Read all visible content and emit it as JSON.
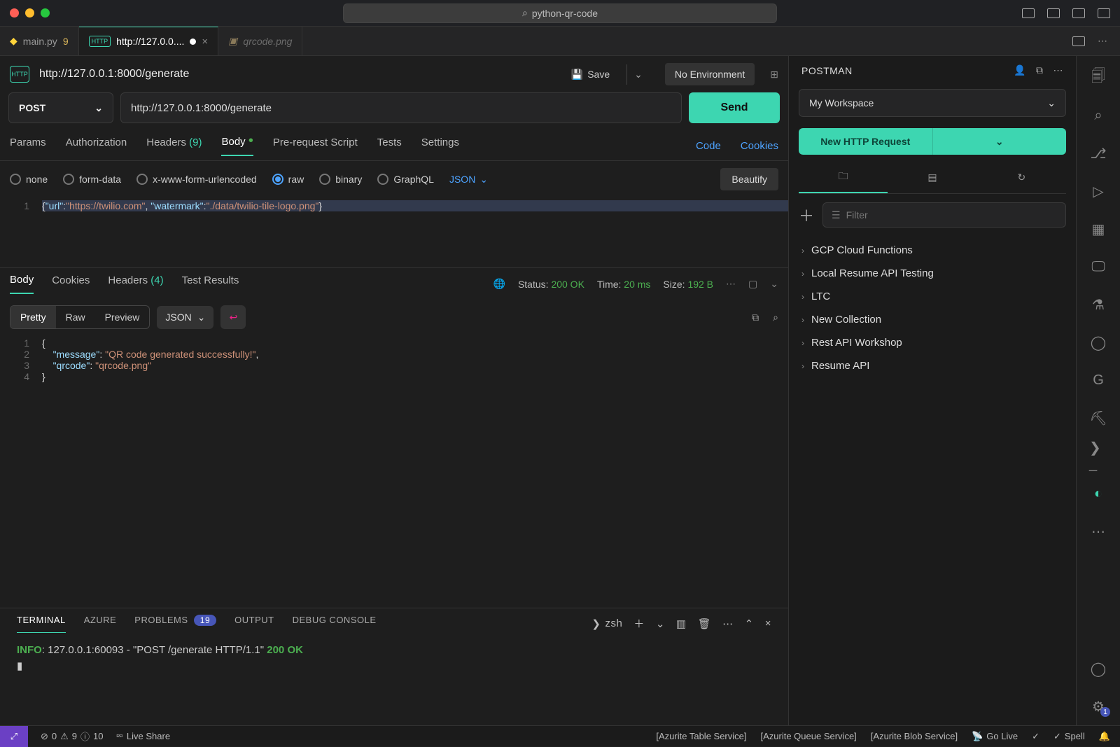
{
  "titlebar": {
    "search": "python-qr-code"
  },
  "tabs": [
    {
      "icon": "python-icon",
      "label": "main.py",
      "badge": "9"
    },
    {
      "icon": "http-icon",
      "label": "http://127.0.0....",
      "modified": true,
      "active": true
    },
    {
      "icon": "image-icon",
      "label": "qrcode.png",
      "dim": true
    }
  ],
  "request": {
    "title": "http://127.0.0.1:8000/generate",
    "save": "Save",
    "environment": "No Environment",
    "method": "POST",
    "url": "http://127.0.0.1:8000/generate",
    "send": "Send"
  },
  "reqTabs": {
    "params": "Params",
    "auth": "Authorization",
    "headers": "Headers",
    "headersCount": "(9)",
    "body": "Body",
    "prereq": "Pre-request Script",
    "tests": "Tests",
    "settings": "Settings",
    "code": "Code",
    "cookies": "Cookies"
  },
  "bodyOpts": {
    "none": "none",
    "formdata": "form-data",
    "xwww": "x-www-form-urlencoded",
    "raw": "raw",
    "binary": "binary",
    "graphql": "GraphQL",
    "type": "JSON",
    "beautify": "Beautify"
  },
  "reqBody": {
    "url_key": "\"url\"",
    "url_val": "\"https://twilio.com\"",
    "wm_key": "\"watermark\"",
    "wm_val": "\"./data/twilio-tile-logo.png\""
  },
  "respTabs": {
    "body": "Body",
    "cookies": "Cookies",
    "headers": "Headers",
    "headersCount": "(4)",
    "results": "Test Results"
  },
  "respInfo": {
    "statusLbl": "Status:",
    "status": "200 OK",
    "timeLbl": "Time:",
    "time": "20 ms",
    "sizeLbl": "Size:",
    "size": "192 B"
  },
  "respView": {
    "pretty": "Pretty",
    "raw": "Raw",
    "preview": "Preview",
    "json": "JSON"
  },
  "respBody": {
    "msg_key": "\"message\"",
    "msg_val": "\"QR code generated successfully!\"",
    "qr_key": "\"qrcode\"",
    "qr_val": "\"qrcode.png\""
  },
  "termTabs": {
    "terminal": "TERMINAL",
    "azure": "AZURE",
    "problems": "PROBLEMS",
    "problemsCount": "19",
    "output": "OUTPUT",
    "debug": "DEBUG CONSOLE",
    "shell": "zsh"
  },
  "termLine": {
    "info": "INFO",
    "sep": ":",
    "rest": "    127.0.0.1:60093 - \"POST /generate HTTP/1.1\" ",
    "code": "200 OK"
  },
  "postman": {
    "title": "POSTMAN",
    "workspace": "My Workspace",
    "newReq": "New HTTP Request",
    "filter": "Filter",
    "collections": [
      "GCP Cloud Functions",
      "Local Resume API Testing",
      "LTC",
      "New Collection",
      "Rest API Workshop",
      "Resume API"
    ]
  },
  "status": {
    "errors": "0",
    "warnings": "9",
    "info": "10",
    "liveshare": "Live Share",
    "azuriteTable": "[Azurite Table Service]",
    "azuriteQueue": "[Azurite Queue Service]",
    "azuriteBlob": "[Azurite Blob Service]",
    "golive": "Go Live",
    "check": "",
    "spell": "Spell"
  }
}
